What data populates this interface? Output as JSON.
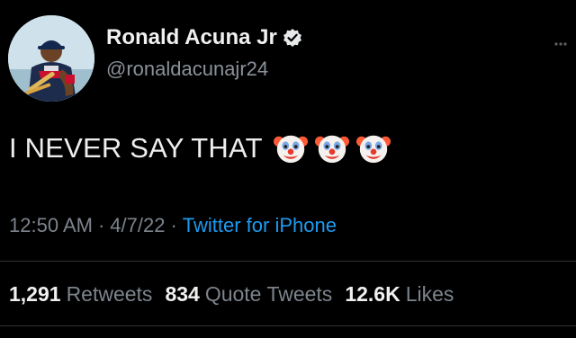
{
  "author": {
    "display_name": "Ronald Acuna Jr",
    "handle": "@ronaldacunajr24",
    "avatar_icon": "player-photo-avatar",
    "verified_icon": "verified-badge-icon"
  },
  "tweet": {
    "text": "I NEVER SAY THAT",
    "emojis": [
      "clown-face-emoji",
      "clown-face-emoji",
      "clown-face-emoji"
    ]
  },
  "meta": {
    "time": "12:50 AM",
    "separator": "·",
    "date": "4/7/22",
    "source": "Twitter for iPhone"
  },
  "stats": {
    "retweets_count": "1,291",
    "retweets_label": "Retweets",
    "quotes_count": "834",
    "quotes_label": "Quote Tweets",
    "likes_count": "12.6K",
    "likes_label": "Likes"
  },
  "colors": {
    "background": "#000000",
    "link": "#1d9bf0",
    "secondary_text": "#7d848c",
    "primary_text": "#e7e9ea"
  }
}
